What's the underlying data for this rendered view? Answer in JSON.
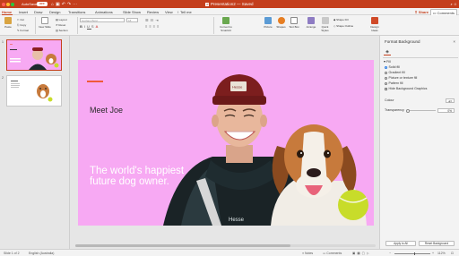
{
  "window": {
    "autosave_label": "AutoSave",
    "autosave_state": "OFF",
    "title": "Presentation2 — Saved",
    "app_glyph": "P",
    "search_icon": "search-icon",
    "smiley_icon": "smiley-icon"
  },
  "tabs": [
    {
      "label": "Home",
      "active": true
    },
    {
      "label": "Insert"
    },
    {
      "label": "Draw"
    },
    {
      "label": "Design"
    },
    {
      "label": "Transitions"
    },
    {
      "label": "Animations"
    },
    {
      "label": "Slide Show"
    },
    {
      "label": "Review"
    },
    {
      "label": "View"
    },
    {
      "label": "Tell me"
    }
  ],
  "share_label": "Share",
  "comments_label": "Comments",
  "ribbon": {
    "paste": "Paste",
    "cut": "Cut",
    "copy": "Copy",
    "format": "Format",
    "new_slide": "New Slide",
    "layout": "Layout",
    "reset": "Reset",
    "section": "Section",
    "font_name": "Gotham Bold",
    "font_size": "18",
    "convert_smartart": "Convert to SmartArt",
    "picture": "Picture",
    "shapes": "Shapes",
    "text_box": "Text Box",
    "arrange": "Arrange",
    "quick_styles": "Quick Styles",
    "shape_fill": "Shape Fill",
    "shape_outline": "Shape Outline",
    "design_ideas": "Design Ideas"
  },
  "thumbnails": [
    {
      "number": "1",
      "selected": true
    },
    {
      "number": "2",
      "selected": false
    }
  ],
  "slide": {
    "heading": "Meet Joe",
    "tagline": "The world's happiest future dog owner.",
    "background": "#f7a9f3",
    "accent": "#ef5a3a"
  },
  "format_pane": {
    "title": "Format Background",
    "close_glyph": "×",
    "section": "Fill",
    "options": [
      {
        "label": "Solid fill",
        "selected": true
      },
      {
        "label": "Gradient fill",
        "selected": false
      },
      {
        "label": "Picture or texture fill",
        "selected": false
      },
      {
        "label": "Pattern fill",
        "selected": false
      }
    ],
    "hide_graphics": "Hide Background Graphics",
    "colour_label": "Colour",
    "transparency_label": "Transparency",
    "transparency_value": "0%",
    "apply_all": "Apply to All",
    "reset_background": "Reset Background"
  },
  "status": {
    "slide_info": "Slide 1 of 2",
    "language": "English (Australia)",
    "notes": "Notes",
    "comments": "Comments",
    "zoom": "112%"
  },
  "colors": {
    "brand": "#c43e1c",
    "slide_bg": "#f7a9f3"
  }
}
